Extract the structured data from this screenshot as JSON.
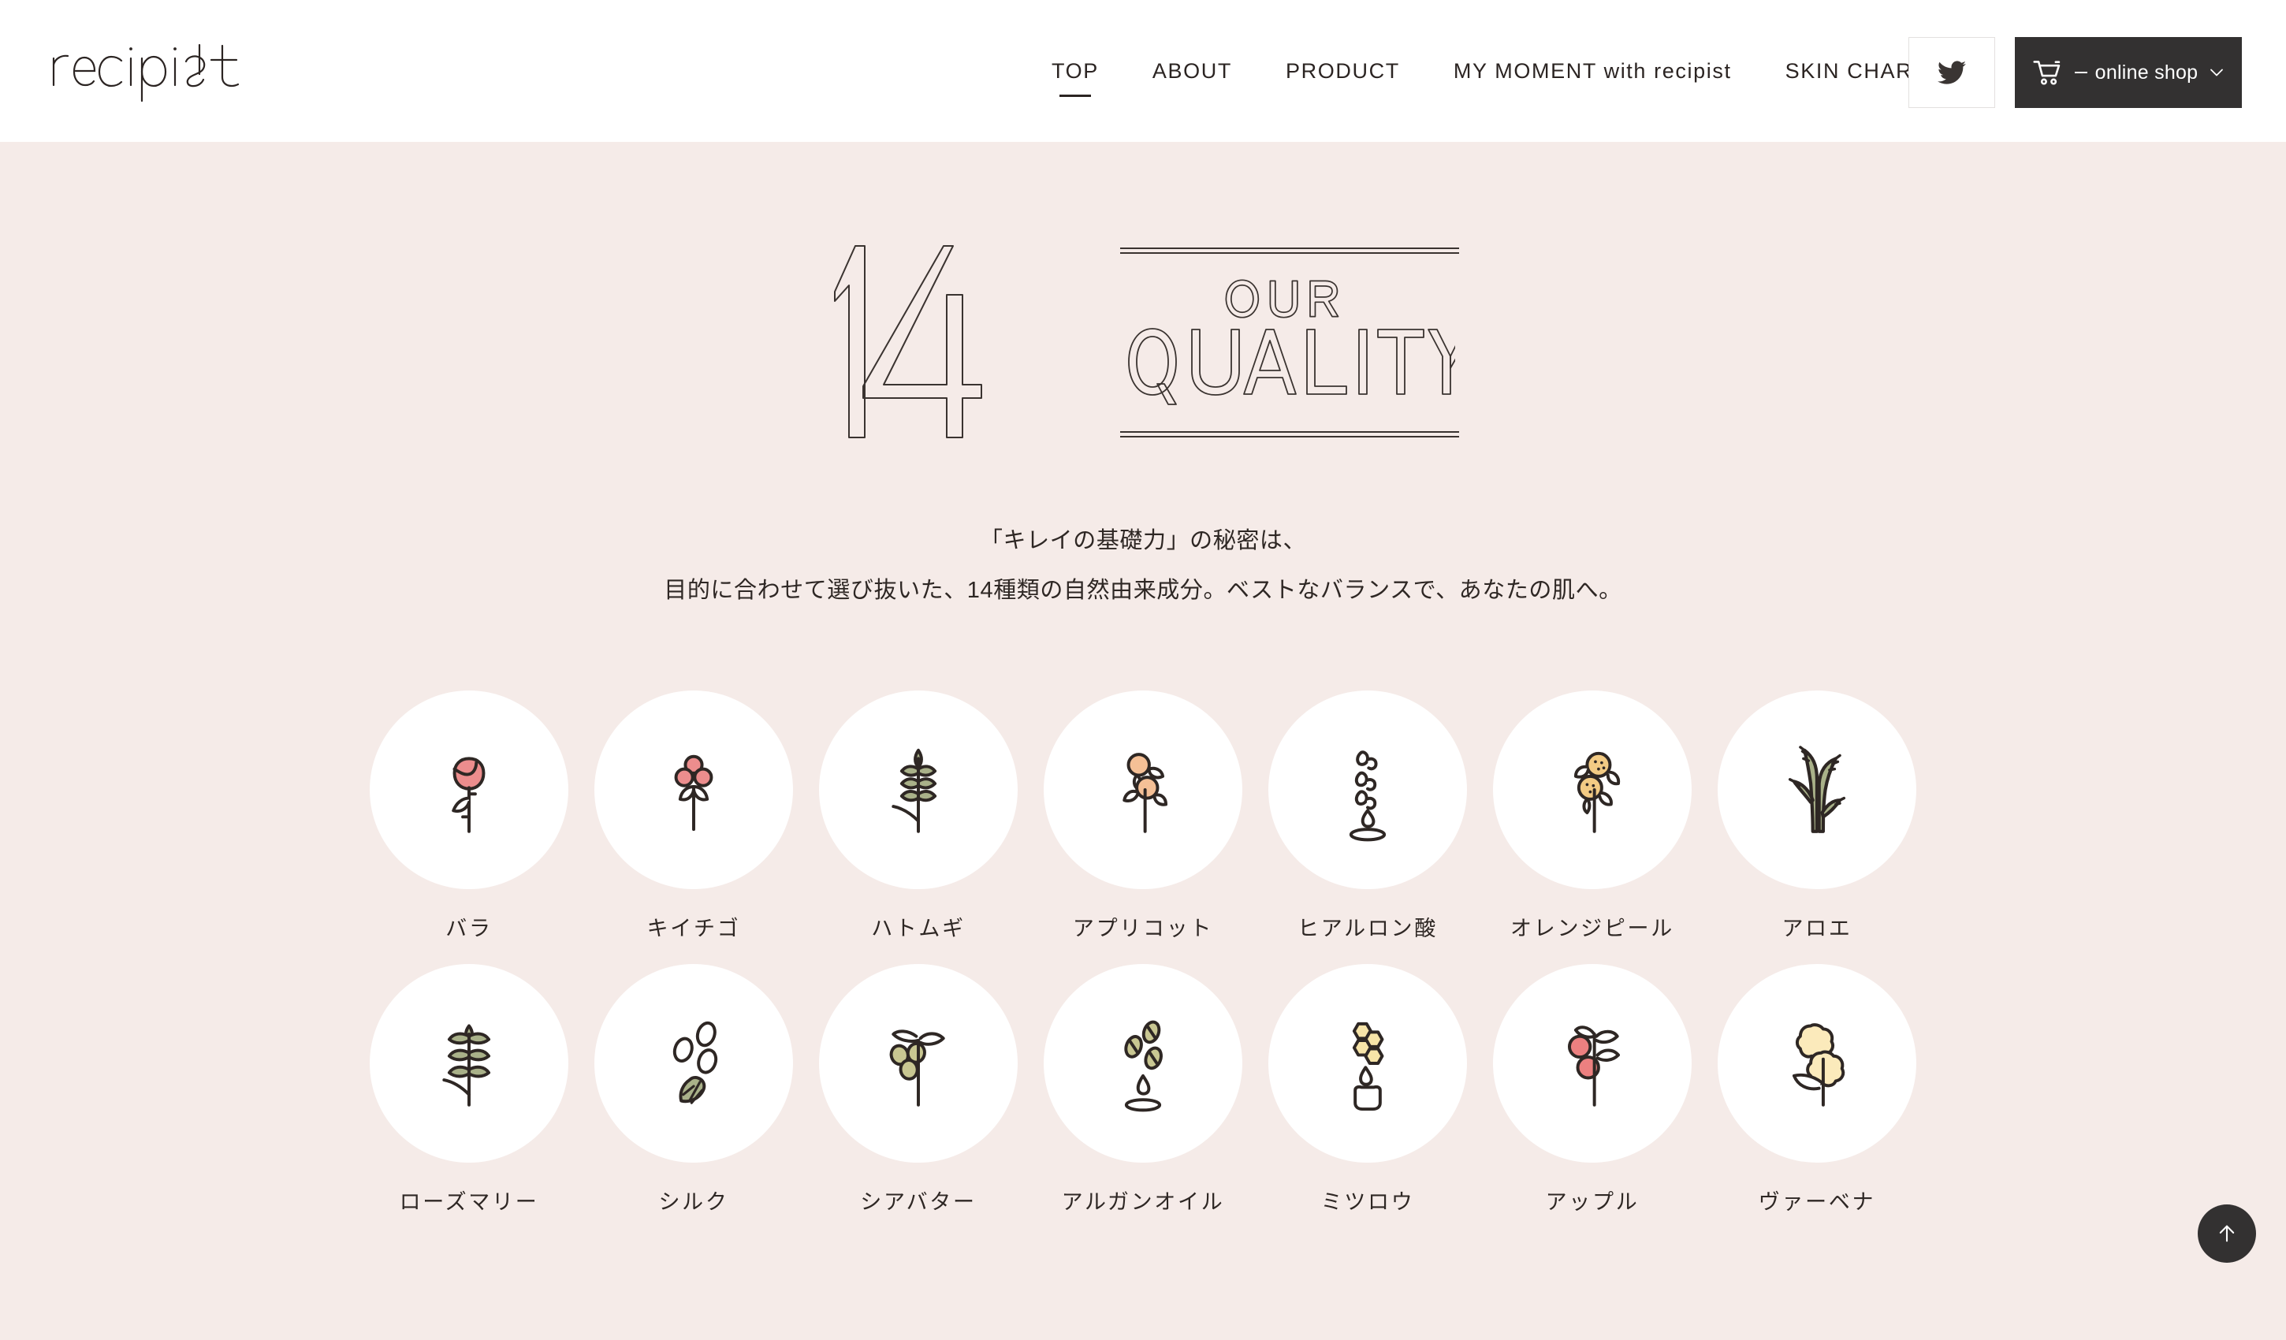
{
  "site": {
    "logo_text": "recipist",
    "background_color": "#f5ebe8",
    "header_background": "#ffffff",
    "accent_dark": "#333131"
  },
  "nav": {
    "items": [
      {
        "label": "TOP",
        "active": true
      },
      {
        "label": "ABOUT",
        "active": false
      },
      {
        "label": "PRODUCT",
        "active": false
      },
      {
        "label": "MY MOMENT with recipist",
        "active": false
      },
      {
        "label": "SKIN CHART",
        "active": false
      }
    ],
    "twitter_icon": "twitter-bird-icon",
    "shop": {
      "cart_icon": "shopping-cart-icon",
      "separator": "—",
      "label": "online shop",
      "chevron_icon": "chevron-down-icon"
    }
  },
  "hero": {
    "number": "14",
    "line_top": "OUR",
    "line_bottom": "QUALITY"
  },
  "lead": {
    "line1": "「キレイの基礎力」の秘密は、",
    "line2": "目的に合わせて選び抜いた、14種類の自然由来成分。ベストなバランスで、あなたの肌へ。"
  },
  "ingredients": {
    "row1": [
      {
        "label": "バラ",
        "icon": "rose-icon",
        "color": "#ec8d8d"
      },
      {
        "label": "キイチゴ",
        "icon": "raspberry-icon",
        "color": "#ec8d8d"
      },
      {
        "label": "ハトムギ",
        "icon": "job-tears-icon",
        "color": "#a9b189"
      },
      {
        "label": "アプリコット",
        "icon": "apricot-icon",
        "color": "#f5c096"
      },
      {
        "label": "ヒアルロン酸",
        "icon": "hyaluronic-icon",
        "color": "#ffffff"
      },
      {
        "label": "オレンジピール",
        "icon": "orange-peel-icon",
        "color": "#f3cb84"
      },
      {
        "label": "アロエ",
        "icon": "aloe-icon",
        "color": "#a9b189"
      }
    ],
    "row2": [
      {
        "label": "ローズマリー",
        "icon": "rosemary-icon",
        "color": "#a9b189"
      },
      {
        "label": "シルク",
        "icon": "silk-icon",
        "color": "#a9b189"
      },
      {
        "label": "シアバター",
        "icon": "shea-butter-icon",
        "color": "#c9c792"
      },
      {
        "label": "アルガンオイル",
        "icon": "argan-oil-icon",
        "color": "#c9c792"
      },
      {
        "label": "ミツロウ",
        "icon": "beeswax-icon",
        "color": "#f7e4a8"
      },
      {
        "label": "アップル",
        "icon": "apple-icon",
        "color": "#ec8080"
      },
      {
        "label": "ヴァーベナ",
        "icon": "verbena-icon",
        "color": "#fbeabb"
      }
    ]
  },
  "scroll_top": {
    "icon": "arrow-up-icon"
  }
}
